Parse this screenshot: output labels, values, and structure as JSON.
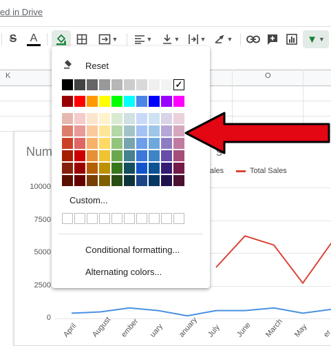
{
  "header": {
    "saved_text": "ed in Drive"
  },
  "toolbar": {
    "strike_glyph": "S",
    "text_color_glyph": "A",
    "filter_glyph": "▼",
    "icons": [
      "strikethrough-icon",
      "text-color-icon",
      "fill-color-icon",
      "borders-icon",
      "merge-cells-icon",
      "horizontal-align-icon",
      "vertical-align-icon",
      "text-wrap-icon",
      "text-rotation-icon",
      "insert-link-icon",
      "insert-comment-icon",
      "insert-chart-icon",
      "filter-icon"
    ]
  },
  "sheet": {
    "columns": [
      "K",
      "O"
    ]
  },
  "chart": {
    "title_start": "Num",
    "title_end": "s",
    "legend": {
      "partial_series": "ales",
      "total_series": "Total Sales",
      "total_color": "#db4437"
    },
    "y_ticks": [
      "10000",
      "7500",
      "5000",
      "2500",
      "0"
    ],
    "x_ticks": [
      "April",
      "August",
      "ember",
      "uary",
      "anuary",
      "July",
      "June",
      "March",
      "May",
      "er"
    ]
  },
  "chart_data": {
    "type": "line",
    "categories": [
      "April",
      "August",
      "ember",
      "uary",
      "anuary",
      "July",
      "June",
      "March",
      "May",
      "er"
    ],
    "ylim": [
      0,
      10000
    ],
    "grid": true,
    "legend_position": "top",
    "series": [
      {
        "name": "Total Sales",
        "color": "#db4437",
        "values": [
          null,
          null,
          null,
          null,
          null,
          3900,
          6300,
          5600,
          2700,
          5800
        ]
      },
      {
        "name": "",
        "color": "#4a90e2",
        "values": [
          400,
          500,
          800,
          600,
          200,
          600,
          600,
          800,
          400,
          700
        ]
      }
    ]
  },
  "fill_menu": {
    "reset_label": "Reset",
    "custom_label": "Custom...",
    "conditional_label": "Conditional formatting...",
    "alternating_label": "Alternating colors...",
    "selected_check": "✓",
    "grays": [
      "#000000",
      "#434343",
      "#666666",
      "#999999",
      "#b7b7b7",
      "#cccccc",
      "#d9d9d9",
      "#efefef",
      "#f3f3f3",
      "#ffffff"
    ],
    "brights": [
      "#980000",
      "#ff0000",
      "#ff9900",
      "#ffff00",
      "#00ff00",
      "#00ffff",
      "#4a86e8",
      "#0000ff",
      "#9900ff",
      "#ff00ff"
    ],
    "shades": [
      [
        "#e6b8af",
        "#f4cccc",
        "#fce5cd",
        "#fff2cc",
        "#d9ead3",
        "#d0e0e3",
        "#c9daf8",
        "#cfe2f3",
        "#d9d2e9",
        "#ead1dc"
      ],
      [
        "#dd7e6b",
        "#ea9999",
        "#f9cb9c",
        "#ffe599",
        "#b6d7a8",
        "#a2c4c9",
        "#a4c2f4",
        "#9fc5e8",
        "#b4a7d6",
        "#d5a6bd"
      ],
      [
        "#cc4125",
        "#e06666",
        "#f6b26b",
        "#ffd966",
        "#93c47d",
        "#76a5af",
        "#6d9eeb",
        "#6fa8dc",
        "#8e7cc3",
        "#c27ba0"
      ],
      [
        "#a61c00",
        "#cc0000",
        "#e69138",
        "#f1c232",
        "#6aa84f",
        "#45818e",
        "#3c78d8",
        "#3d85c6",
        "#674ea7",
        "#a64d79"
      ],
      [
        "#85200c",
        "#990000",
        "#b45f06",
        "#bf9000",
        "#38761d",
        "#134f5c",
        "#1155cc",
        "#0b5394",
        "#351c75",
        "#741b47"
      ],
      [
        "#5b0f00",
        "#660000",
        "#783f04",
        "#7f6000",
        "#274e13",
        "#0c343d",
        "#1c4587",
        "#073763",
        "#20124d",
        "#4c1130"
      ]
    ]
  },
  "annotation": {
    "arrow_color": "#e30613"
  }
}
